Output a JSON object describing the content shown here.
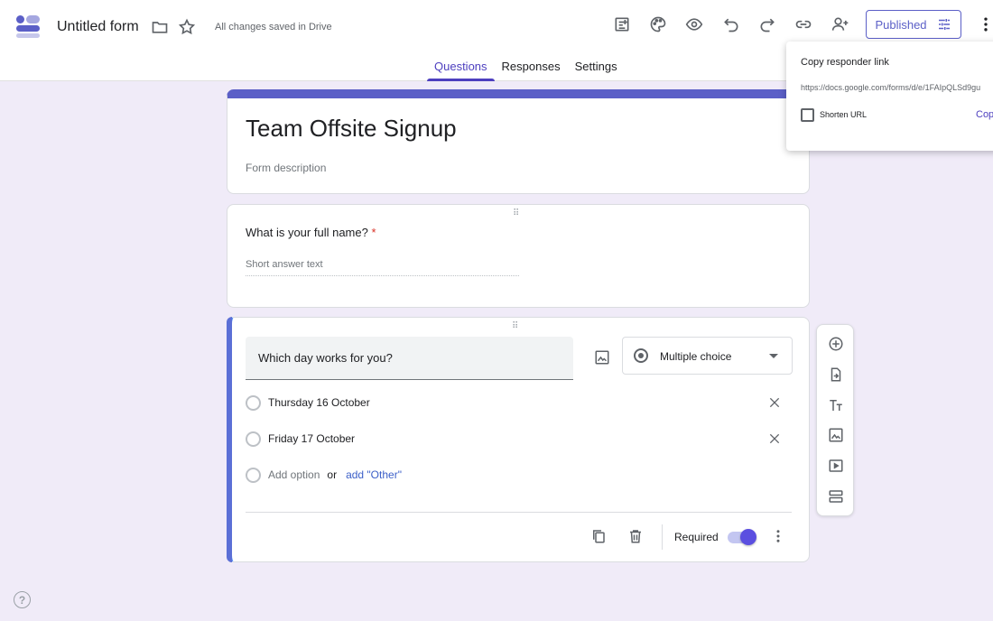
{
  "header": {
    "form_title": "Untitled form",
    "save_status": "All changes saved in Drive",
    "published_label": "Published",
    "icons": [
      "folder-icon",
      "star-icon",
      "addons-icon",
      "palette-icon",
      "preview-icon",
      "undo-icon",
      "redo-icon",
      "link-icon",
      "add-collaborator-icon",
      "settings-sliders-icon",
      "more-vert-icon"
    ]
  },
  "tabs": [
    {
      "label": "Questions",
      "active": true
    },
    {
      "label": "Responses",
      "active": false
    },
    {
      "label": "Settings",
      "active": false
    }
  ],
  "popover": {
    "title": "Copy responder link",
    "url": "https://docs.google.com/forms/d/e/1FAIpQLSd9gu",
    "shorten_label": "Shorten URL",
    "shorten_checked": false,
    "copy_label": "Copy"
  },
  "title_card": {
    "title": "Team Offsite Signup",
    "description_placeholder": "Form description"
  },
  "question1": {
    "text": "What is your full name?",
    "required_mark": "*",
    "answer_placeholder": "Short answer text"
  },
  "question2": {
    "text": "Which day works for you?",
    "type": "Multiple choice",
    "options": [
      {
        "label": "Thursday 16 October"
      },
      {
        "label": "Friday 17 October"
      }
    ],
    "add_option": "Add option",
    "or": "or",
    "add_other": "add \"Other\"",
    "required_label": "Required",
    "required": true
  },
  "colors": {
    "accent": "#5b5fc7",
    "background": "#f0ebf8",
    "tab_active": "#4d3fbf",
    "link": "#3c5fc8"
  },
  "help_glyph": "?"
}
